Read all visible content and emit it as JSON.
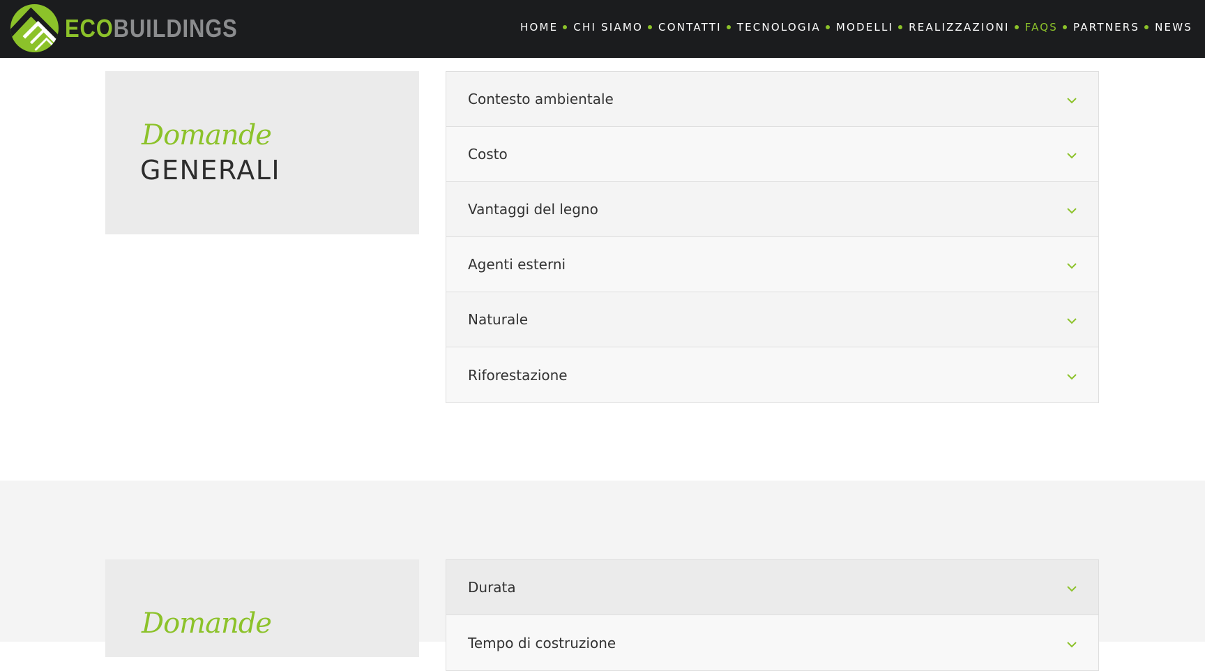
{
  "brand": {
    "name_part1": "ECO",
    "name_part2": "BUILDINGS",
    "icon": "mountain-logo-icon",
    "colors": {
      "accent": "#8cc22a",
      "header_bg": "#1b1c1e",
      "gray_text": "#8b8c8e"
    }
  },
  "nav": {
    "items": [
      {
        "label": "HOME",
        "active": false
      },
      {
        "label": "CHI SIAMO",
        "active": false
      },
      {
        "label": "CONTATTI",
        "active": false
      },
      {
        "label": "TECNOLOGIA",
        "active": false
      },
      {
        "label": "MODELLI",
        "active": false
      },
      {
        "label": "REALIZZAZIONI",
        "active": false
      },
      {
        "label": "FAQS",
        "active": true
      },
      {
        "label": "PARTNERS",
        "active": false
      },
      {
        "label": "NEWS",
        "active": false
      }
    ]
  },
  "sections": [
    {
      "script_label": "Domande",
      "title": "GENERALI",
      "items": [
        "Contesto ambientale",
        "Costo",
        "Vantaggi del legno",
        "Agenti esterni",
        "Naturale",
        "Riforestazione"
      ]
    },
    {
      "script_label": "Domande",
      "items": [
        "Durata",
        "Tempo di costruzione"
      ]
    }
  ]
}
